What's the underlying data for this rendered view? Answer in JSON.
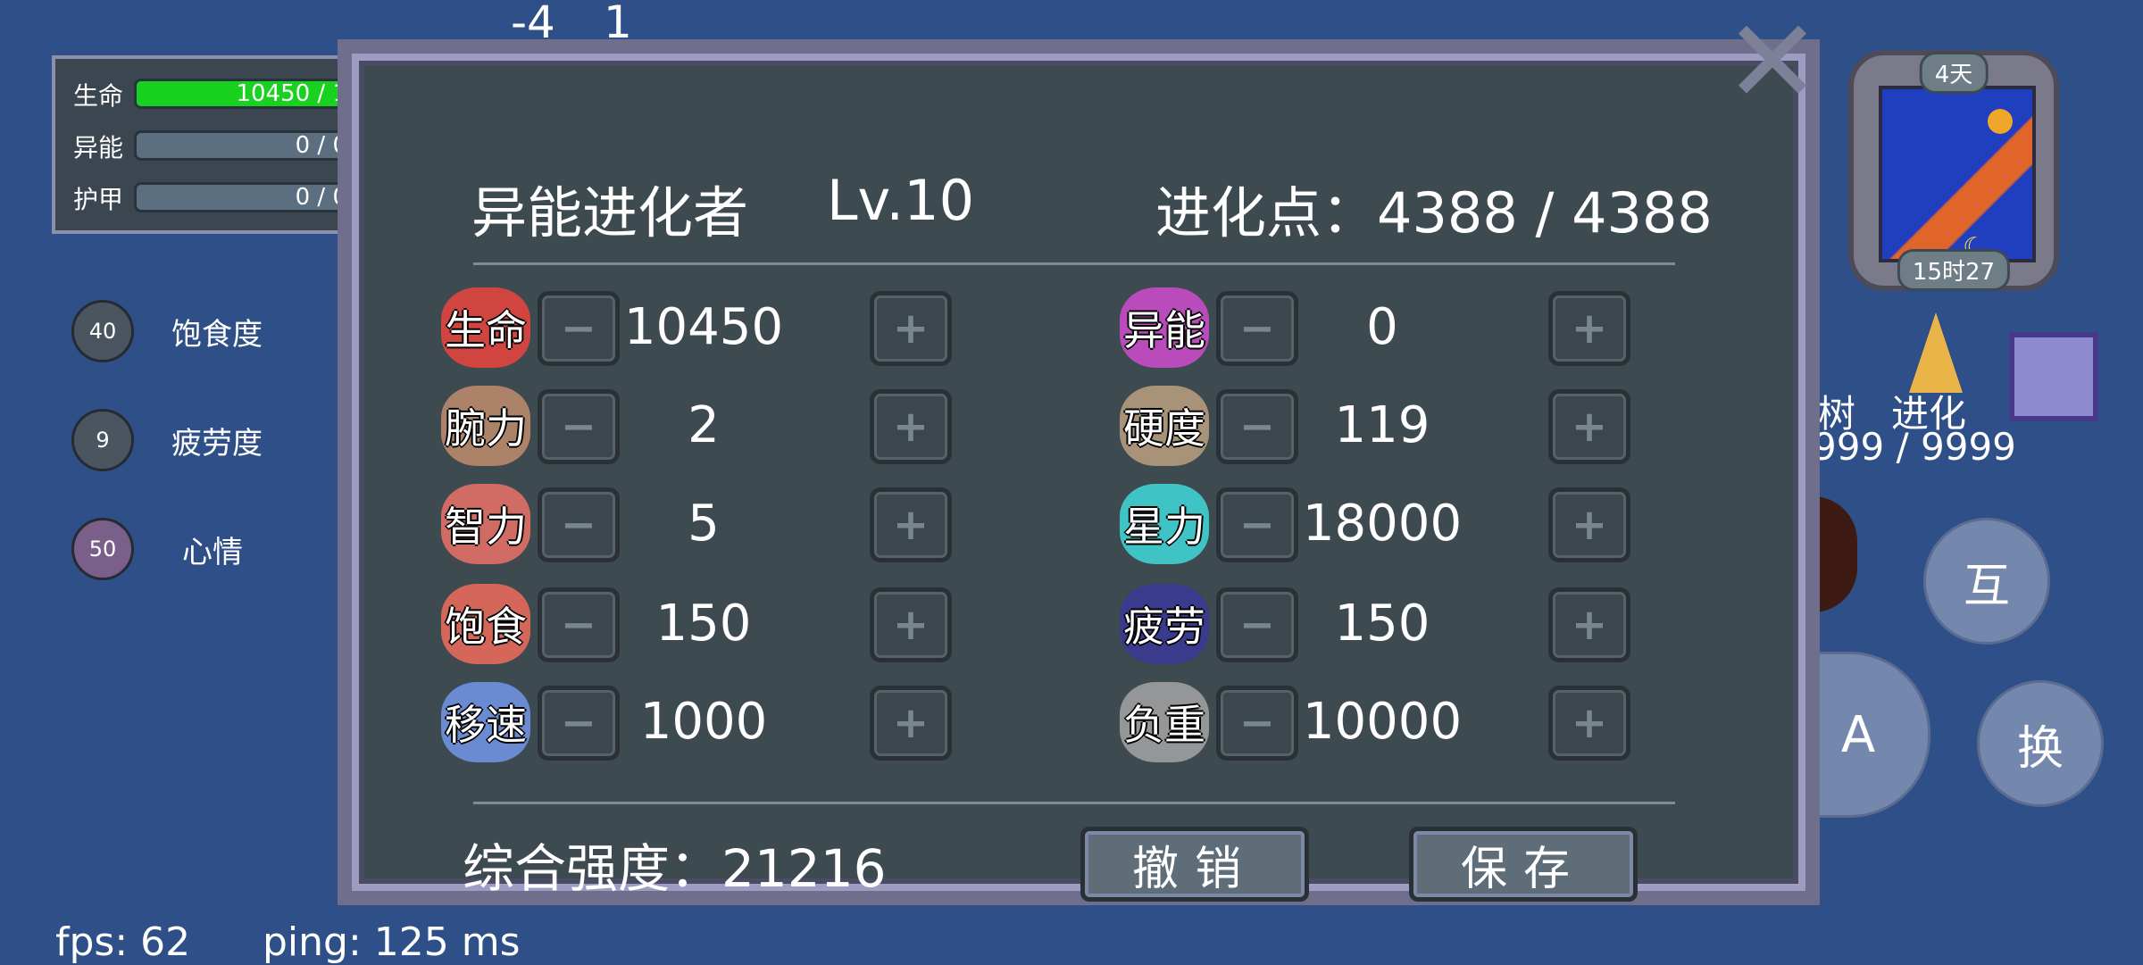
{
  "world": {
    "coord_x": "-4",
    "coord_y": "1",
    "fps": "fps: 62",
    "ping": "ping: 125 ms"
  },
  "status": {
    "hp_label": "生命",
    "hp_text": "10450 / 1",
    "hp_fill": 1.0,
    "energy_label": "异能",
    "energy_text": "0 / 0",
    "armor_label": "护甲",
    "armor_text": "0 / 0"
  },
  "needs": [
    {
      "label": "饱食度",
      "value": "40",
      "icon": "food-icon"
    },
    {
      "label": "疲劳度",
      "value": "9",
      "icon": "fatigue-icon"
    },
    {
      "label": "心情",
      "value": "50",
      "icon": "heart-icon"
    }
  ],
  "clock": {
    "day": "4天",
    "time": "15时27"
  },
  "hud": {
    "tree_label": "树",
    "evolve_label": "进化",
    "resource_text": "999 / 9999",
    "interact_label": "互",
    "attack_label": "A",
    "swap_label": "换"
  },
  "dialog": {
    "title": "异能进化者",
    "level": "Lv.10",
    "points": "进化点：4388 / 4388",
    "minus": "−",
    "plus": "+",
    "left_attrs": [
      {
        "label": "生命",
        "value": "10450",
        "icon": "heart-icon",
        "color": "#e0453e"
      },
      {
        "label": "腕力",
        "value": "2",
        "icon": "fist-icon",
        "color": "#b8896a"
      },
      {
        "label": "智力",
        "value": "5",
        "icon": "brain-icon",
        "color": "#e07066"
      },
      {
        "label": "饱食",
        "value": "150",
        "icon": "meat-icon",
        "color": "#e46a5a"
      },
      {
        "label": "移速",
        "value": "1000",
        "icon": "wing-icon",
        "color": "#6f92e0"
      }
    ],
    "right_attrs": [
      {
        "label": "异能",
        "value": "0",
        "icon": "magic-star-icon",
        "color": "#c64bc6"
      },
      {
        "label": "硬度",
        "value": "119",
        "icon": "shield-icon",
        "color": "#b49a7c"
      },
      {
        "label": "星力",
        "value": "18000",
        "icon": "star-icon",
        "color": "#3fd0d0"
      },
      {
        "label": "疲劳",
        "value": "150",
        "icon": "fatigue-icon",
        "color": "#3a3a94"
      },
      {
        "label": "负重",
        "value": "10000",
        "icon": "weight-icon",
        "color": "#9e9e9e"
      }
    ],
    "strength": "综合强度：21216",
    "undo_label": "撤销",
    "save_label": "保存"
  }
}
